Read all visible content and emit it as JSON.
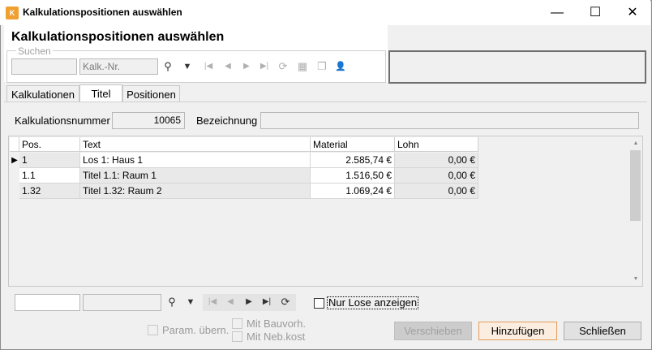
{
  "window": {
    "title": "Kalkulationspositionen auswählen",
    "icon_text": "K",
    "controls": {
      "minimize": "—",
      "maximize": "☐",
      "close": "✕"
    }
  },
  "header": {
    "title": "Kalkulationspositionen auswählen",
    "search_group_label": "Suchen",
    "search_placeholder_1": "",
    "search_placeholder_2": "Kalk.-Nr.",
    "toolbar_icons": {
      "search": "⚲",
      "filter": "▼",
      "first": "|◀",
      "prev": "◀",
      "next": "▶",
      "last": "▶|",
      "refresh": "⟳",
      "grid_settings": "▦",
      "copy": "❐",
      "user": "👤"
    }
  },
  "tabs": [
    {
      "label": "Kalkulationen"
    },
    {
      "label": "Titel"
    },
    {
      "label": "Positionen"
    }
  ],
  "form": {
    "kalkulationsnummer_label": "Kalkulationsnummer",
    "kalkulationsnummer_value": "10065",
    "bezeichnung_label": "Bezeichnung",
    "bezeichnung_value": ""
  },
  "table": {
    "columns": [
      "Pos.",
      "Text",
      "Material",
      "Lohn"
    ],
    "rows": [
      {
        "pos": "1",
        "text": "Los 1: Haus 1",
        "material": "2.585,74 €",
        "lohn": "0,00 €"
      },
      {
        "pos": "1.1",
        "text": "Titel 1.1: Raum 1",
        "material": "1.516,50 €",
        "lohn": "0,00 €"
      },
      {
        "pos": "1.32",
        "text": "Titel 1.32: Raum 2",
        "material": "1.069,24 €",
        "lohn": "0,00 €"
      }
    ],
    "current_row_marker": "▶",
    "scroll_up": "▲",
    "scroll_down": "▼"
  },
  "footer": {
    "nur_lose_label": "Nur Lose anzeigen",
    "nur_lose_checked": false,
    "nav_icons": {
      "search": "⚲",
      "filter": "▼",
      "first": "|◀",
      "prev": "◀",
      "next": "▶",
      "last": "▶|",
      "refresh": "⟳"
    }
  },
  "options": {
    "param_uebern": "Param. übern.",
    "mit_bauvorh": "Mit Bauvorh.",
    "mit_nebkost": "Mit Neb.kost"
  },
  "buttons": {
    "verschieben": "Verschieben",
    "hinzufuegen": "Hinzufügen",
    "schliessen": "Schließen"
  }
}
